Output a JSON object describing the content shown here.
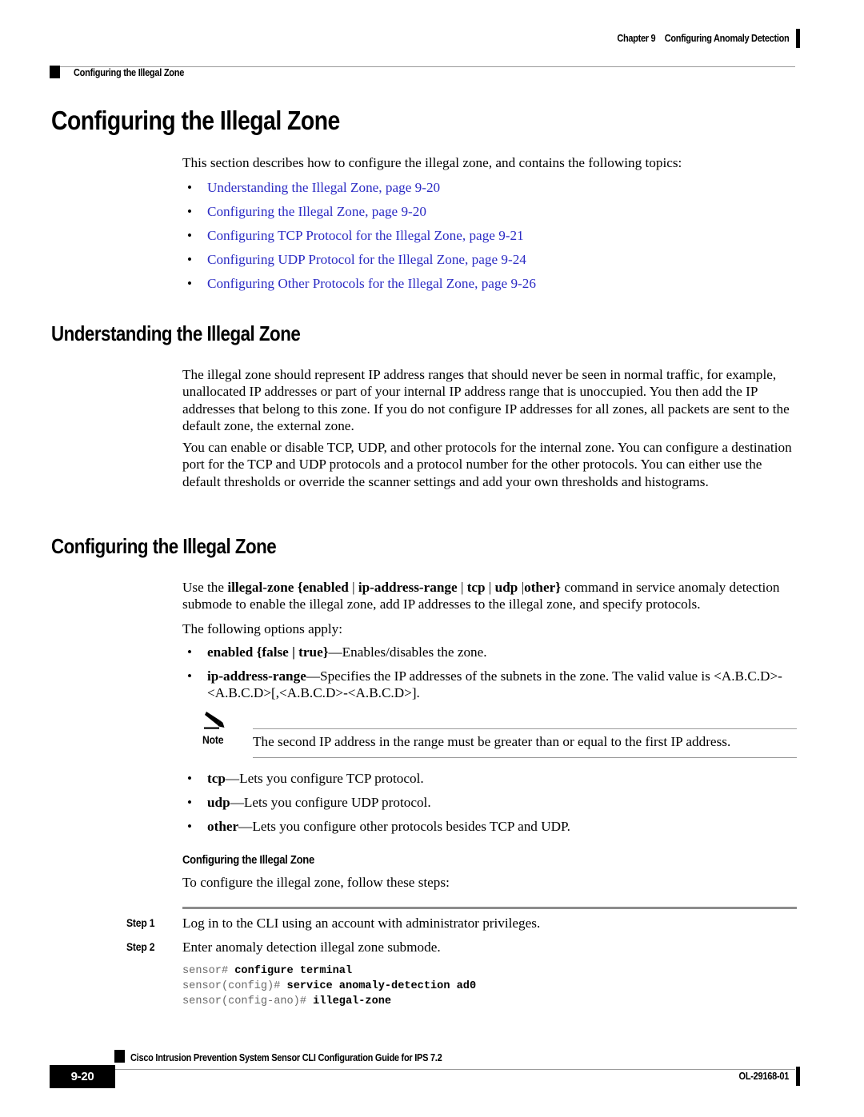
{
  "header": {
    "chapter_number": "Chapter 9",
    "chapter_title": "Configuring Anomaly Detection",
    "running_head": "Configuring the Illegal Zone"
  },
  "footer": {
    "guide_title": "Cisco Intrusion Prevention System Sensor CLI Configuration Guide for IPS 7.2",
    "page_number": "9-20",
    "doc_id": "OL-29168-01"
  },
  "section_main": {
    "heading": "Configuring the Illegal Zone",
    "intro": "This section describes how to configure the illegal zone, and contains the following topics:",
    "topics": [
      "Understanding the Illegal Zone, page 9-20",
      "Configuring the Illegal Zone, page 9-20",
      "Configuring TCP Protocol for the Illegal Zone, page 9-21",
      "Configuring UDP Protocol for the Illegal Zone, page 9-24",
      "Configuring Other Protocols for the Illegal Zone, page 9-26"
    ]
  },
  "section_understanding": {
    "heading": "Understanding the Illegal Zone",
    "paragraph_1": "The illegal zone should represent IP address ranges that should never be seen in normal traffic, for example, unallocated IP addresses or part of your internal IP address range that is unoccupied. You then add the IP addresses that belong to this zone. If you do not configure IP addresses for all zones, all packets are sent to the default zone, the external zone.",
    "paragraph_2": "You can enable or disable TCP, UDP, and other protocols for the internal zone. You can configure a destination port for the TCP and UDP protocols and a protocol number for the other protocols. You can either use the default thresholds or override the scanner settings and add your own thresholds and histograms."
  },
  "section_configuring": {
    "heading": "Configuring the Illegal Zone",
    "usage": {
      "lead": "Use the ",
      "command": "illegal-zone",
      "syntax_open": "{",
      "syntax_parts": [
        "enabled",
        "ip-address-range",
        "tcp",
        "udp",
        "other"
      ],
      "syntax_close": "}",
      "tail": " command in service anomaly detection submode to enable the illegal zone, add IP addresses to the illegal zone, and specify protocols."
    },
    "options_lead": "The following options apply:",
    "options": [
      {
        "term": "enabled",
        "arg": "{false | true}",
        "desc": "—Enables/disables the zone."
      },
      {
        "term": "ip-address-range",
        "desc": "—Specifies the IP addresses of the subnets in the zone. The valid value is <A.B.C.D>-<A.B.C.D>[,<A.B.C.D>-<A.B.C.D>]."
      },
      {
        "term": "tcp",
        "desc": "—Lets you configure TCP protocol."
      },
      {
        "term": "udp",
        "desc": "—Lets you configure UDP protocol."
      },
      {
        "term": "other",
        "desc": "—Lets you configure other protocols besides TCP and UDP."
      }
    ],
    "note": {
      "label": "Note",
      "text": "The second IP address in the range must be greater than or equal to the first IP address.",
      "icon": "pencil-icon"
    },
    "procedure": {
      "heading": "Configuring the Illegal Zone",
      "lead": "To configure the illegal zone, follow these steps:",
      "steps": [
        {
          "label": "Step 1",
          "text": "Log in to the CLI using an account with administrator privileges."
        },
        {
          "label": "Step 2",
          "text": "Enter anomaly detection illegal zone submode."
        }
      ],
      "code_lines": [
        {
          "prompt": "sensor# ",
          "command": "configure terminal"
        },
        {
          "prompt": "sensor(config)# ",
          "command": "service anomaly-detection ad0"
        },
        {
          "prompt": "sensor(config-ano)# ",
          "command": "illegal-zone"
        }
      ]
    }
  },
  "colors": {
    "link": "#2b2bc4",
    "rule": "#9a9a9a",
    "step_rule": "#8c8c8c",
    "code_prompt": "#6a6a6a"
  }
}
